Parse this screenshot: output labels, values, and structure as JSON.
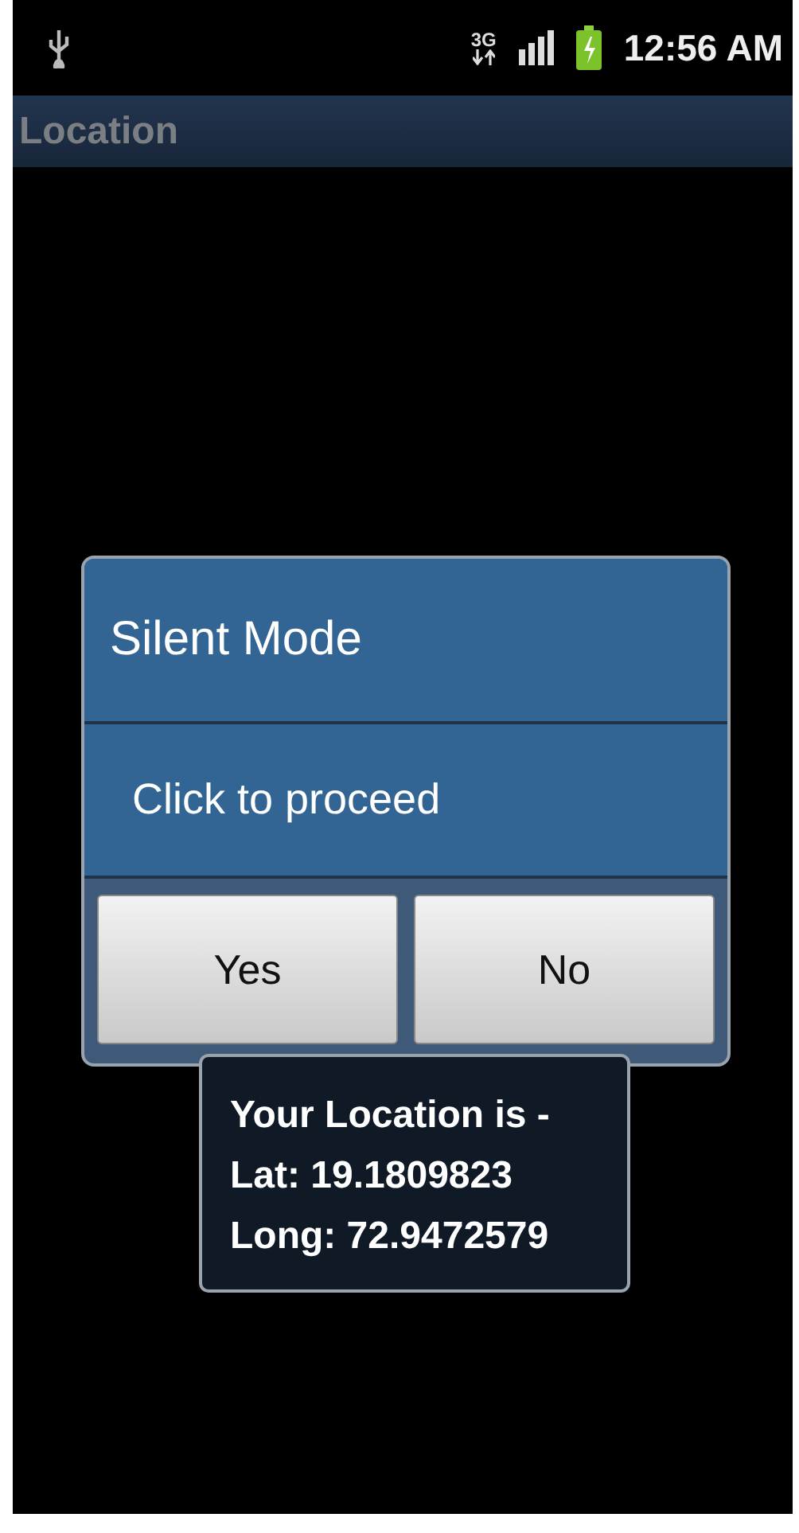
{
  "status_bar": {
    "network_type": "3G",
    "time": "12:56 AM"
  },
  "title_bar": {
    "title": "Location"
  },
  "dialog": {
    "title": "Silent Mode",
    "message": "Click to proceed",
    "buttons": [
      {
        "label": "Yes"
      },
      {
        "label": "No"
      }
    ]
  },
  "toast": {
    "lines": [
      "Your Location is -",
      "Lat: 19.1809823",
      "Long: 72.9472579"
    ]
  }
}
